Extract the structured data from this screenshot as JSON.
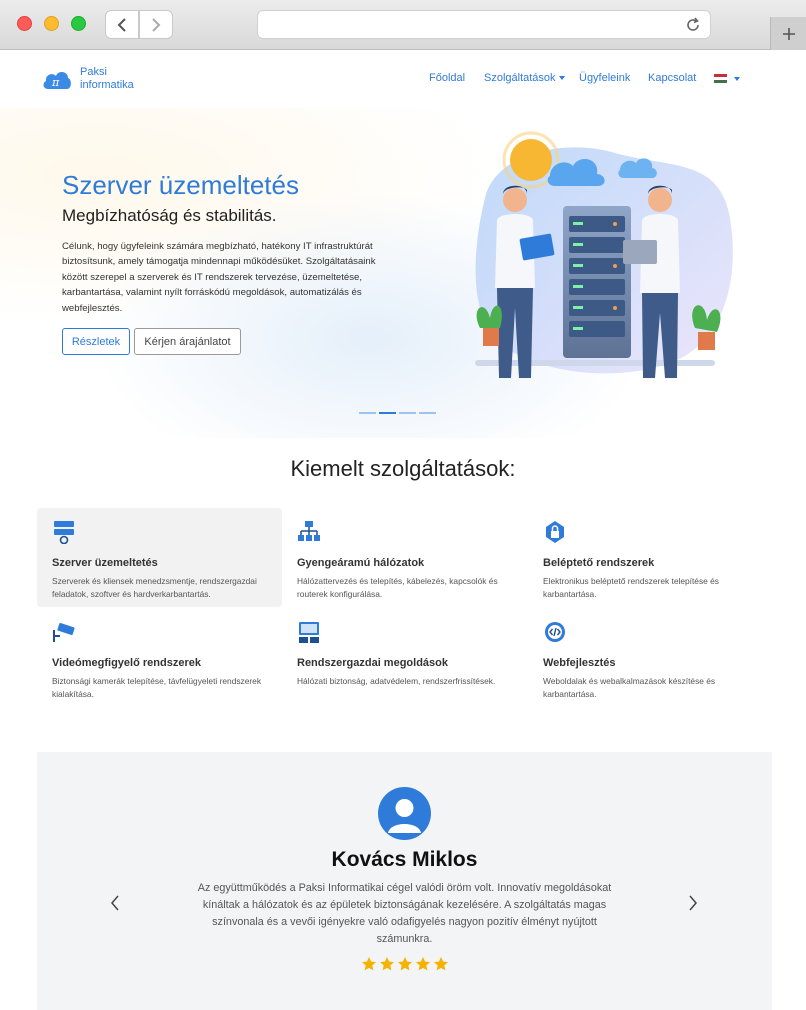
{
  "brand": {
    "line1": "Paksi",
    "line2": "informatika",
    "logo_symbol": "π",
    "logo_color": "#2f7bd9"
  },
  "nav": {
    "home": "Főoldal",
    "services": "Szolgáltatások",
    "clients": "Ügyfeleink",
    "contact": "Kapcsolat",
    "language_icon": "hungarian-flag-icon"
  },
  "hero": {
    "title": "Szerver üzemeltetés",
    "subtitle": "Megbízhatóság és stabilitás.",
    "description": "Célunk, hogy ügyfeleink számára megbízható, hatékony IT infrastruktúrát biztosítsunk, amely támogatja mindennapi működésüket. Szolgáltatásaink között szerepel a szerverek és IT rendszerek tervezése, üzemeltetése, karbantartása, valamint nyílt forráskódú megoldások, automatizálás és webfejlesztés.",
    "primary_button": "Részletek",
    "secondary_button": "Kérjen árajánlatot",
    "slides": 4,
    "active_slide": 2
  },
  "services": {
    "title": "Kiemelt szolgáltatások:",
    "items": [
      {
        "icon": "server-gear-icon",
        "title": "Szerver üzemeltetés",
        "desc": "Szerverek és kliensek menedzsmentje, rendszergazdai feladatok, szoftver és hardverkarbantartás."
      },
      {
        "icon": "network-icon",
        "title": "Gyengeáramú hálózatok",
        "desc": "Hálózattervezés és telepítés, kábelezés, kapcsolók és routerek konfigurálása."
      },
      {
        "icon": "access-lock-icon",
        "title": "Beléptető rendszerek",
        "desc": "Elektronikus beléptető rendszerek telepítése és karbantartása."
      },
      {
        "icon": "security-camera-icon",
        "title": "Videómegfigyelő rendszerek",
        "desc": "Biztonsági kamerák telepítése, távfelügyeleti rendszerek kialakítása."
      },
      {
        "icon": "sysadmin-icon",
        "title": "Rendszergazdai megoldások",
        "desc": "Hálózati biztonság, adatvédelem, rendszerfrissítések."
      },
      {
        "icon": "code-gear-icon",
        "title": "Webfejlesztés",
        "desc": "Weboldalak és webalkalmazások készítése és karbantartása."
      }
    ]
  },
  "testimonial": {
    "name": "Kovács Miklos",
    "quote": "Az együttműködés a Paksi Informatikai cégel valódi öröm volt. Innovatív megoldásokat kínáltak a hálózatok és az épületek biztonságának kezelésére. A szolgáltatás magas színvonala és a vevői igényekre való odafigyelés nagyon pozitív élményt nyújtott számunkra.",
    "rating": 5,
    "star_color": "#f5b301"
  },
  "colors": {
    "accent": "#2f7bd9",
    "card_highlight": "#f2f2f2",
    "testimonial_bg": "#f3f4f6"
  }
}
